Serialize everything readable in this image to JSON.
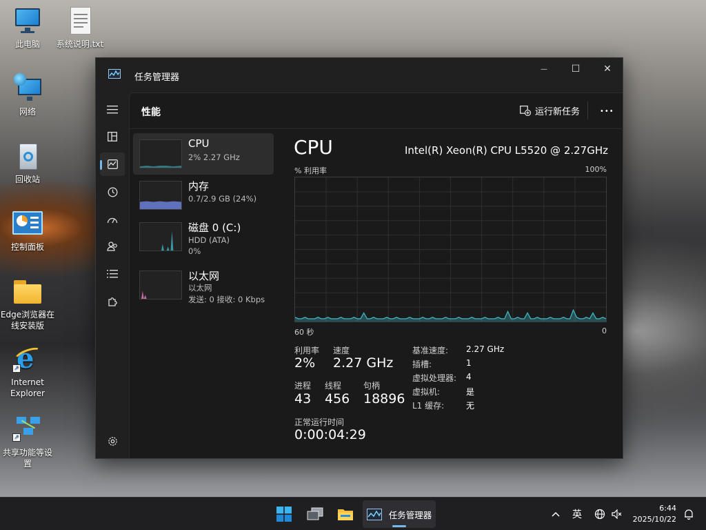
{
  "desktop": {
    "icons": [
      {
        "label": "此电脑"
      },
      {
        "label": "系统说明.txt"
      },
      {
        "label": "网络"
      },
      {
        "label": "回收站"
      },
      {
        "label": "控制面板"
      },
      {
        "label": "Edge浏览器在线安装版"
      },
      {
        "label": "Internet Explorer"
      },
      {
        "label": "共享功能等设置"
      }
    ]
  },
  "window": {
    "title": "任务管理器",
    "controls": {
      "minimize": "—",
      "maximize": "☐",
      "close": "✕"
    }
  },
  "header": {
    "page_title": "性能",
    "run_task_label": "运行新任务",
    "more_label": "•••"
  },
  "perf_items": [
    {
      "name": "CPU",
      "sub1": "2% 2.27 GHz",
      "sub2": ""
    },
    {
      "name": "内存",
      "sub1": "0.7/2.9 GB (24%)",
      "sub2": ""
    },
    {
      "name": "磁盘 0 (C:)",
      "sub1": "HDD (ATA)",
      "sub2": "0%"
    },
    {
      "name": "以太网",
      "sub1": "以太网",
      "sub2": "发送: 0 接收: 0 Kbps"
    }
  ],
  "cpu_detail": {
    "title": "CPU",
    "model": "Intel(R) Xeon(R) CPU L5520 @ 2.27GHz",
    "graph_top_left": "% 利用率",
    "graph_top_right": "100%",
    "graph_bottom_left": "60 秒",
    "graph_bottom_right": "0",
    "stats": {
      "utilization_label": "利用率",
      "utilization_value": "2%",
      "speed_label": "速度",
      "speed_value": "2.27 GHz",
      "processes_label": "进程",
      "processes_value": "43",
      "threads_label": "线程",
      "threads_value": "456",
      "handles_label": "句柄",
      "handles_value": "18896",
      "uptime_label": "正常运行时间",
      "uptime_value": "0:00:04:29"
    },
    "specs": [
      {
        "key": "基准速度:",
        "value": "2.27 GHz"
      },
      {
        "key": "插槽:",
        "value": "1"
      },
      {
        "key": "虚拟处理器:",
        "value": "4"
      },
      {
        "key": "虚拟机:",
        "value": "是"
      },
      {
        "key": "L1 缓存:",
        "value": "无"
      }
    ],
    "utilization_history": [
      3,
      2,
      2,
      3,
      2,
      2,
      2,
      3,
      2,
      2,
      3,
      2,
      2,
      2,
      3,
      2,
      2,
      2,
      3,
      2,
      2,
      6,
      2,
      2,
      3,
      2,
      2,
      2,
      3,
      2,
      2,
      3,
      2,
      2,
      2,
      3,
      2,
      2,
      2,
      3,
      2,
      2,
      3,
      2,
      2,
      2,
      3,
      2,
      2,
      2,
      3,
      2,
      2,
      2,
      3,
      2,
      2,
      2,
      3,
      2,
      2,
      2,
      3,
      2,
      2,
      7,
      2,
      2,
      3,
      2,
      2,
      6,
      2,
      2,
      3,
      2,
      2,
      2,
      3,
      2,
      2,
      2,
      3,
      2,
      2,
      8,
      3,
      2,
      2,
      3,
      2,
      6,
      2,
      2,
      3,
      2
    ]
  },
  "accent_color": "#3fb5c4",
  "taskbar": {
    "active_app_label": "任务管理器",
    "ime_label": "英",
    "time": "6:44",
    "date": "2025/10/22"
  }
}
